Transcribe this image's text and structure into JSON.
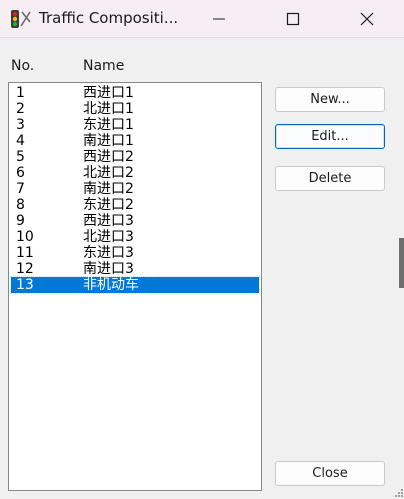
{
  "window": {
    "title": "Traffic Compositi...",
    "icon": "traffic-light-icon"
  },
  "list": {
    "columns": {
      "no": "No.",
      "name": "Name"
    },
    "items": [
      {
        "no": "1",
        "name": "西进口1"
      },
      {
        "no": "2",
        "name": "北进口1"
      },
      {
        "no": "3",
        "name": "东进口1"
      },
      {
        "no": "4",
        "name": "南进口1"
      },
      {
        "no": "5",
        "name": "西进口2"
      },
      {
        "no": "6",
        "name": "北进口2"
      },
      {
        "no": "7",
        "name": "南进口2"
      },
      {
        "no": "8",
        "name": "东进口2"
      },
      {
        "no": "9",
        "name": "西进口3"
      },
      {
        "no": "10",
        "name": "北进口3"
      },
      {
        "no": "11",
        "name": "东进口3"
      },
      {
        "no": "12",
        "name": "南进口3"
      },
      {
        "no": "13",
        "name": "非机动车"
      }
    ],
    "selected_no": "13"
  },
  "buttons": {
    "new": "New...",
    "edit": "Edit...",
    "delete": "Delete",
    "close": "Close"
  },
  "colors": {
    "selection": "#0078d7",
    "titlebar": "#f7eef3"
  }
}
